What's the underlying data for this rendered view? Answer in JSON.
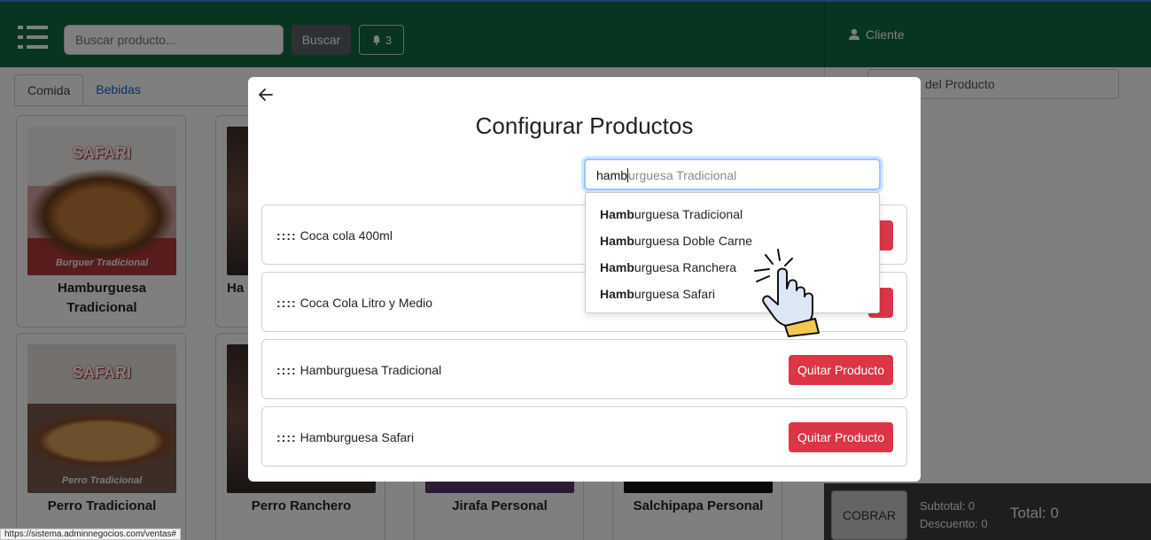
{
  "header": {
    "search_placeholder": "Buscar producto...",
    "search_button": "Buscar",
    "notifications_count": "3",
    "client_label": "Cliente"
  },
  "tabs": [
    {
      "label": "Comida"
    },
    {
      "label": "Bebidas"
    }
  ],
  "products": [
    {
      "name": "Hamburguesa Tradicional",
      "logo": "SAFARI",
      "caption": "Burguer Tradicional"
    },
    {
      "name": "Ha"
    },
    {
      "name": "Perro Tradicional",
      "logo": "SAFARI",
      "caption": "Perro Tradicional"
    },
    {
      "name": "Perro Ranchero"
    },
    {
      "name": "Jirafa Personal"
    },
    {
      "name": "Salchipapa Personal"
    }
  ],
  "right_panel": {
    "product_field_value": "del Producto"
  },
  "footer": {
    "cobrar_label": "COBRAR",
    "subtotal": "Subtotal: 0",
    "discount": "Descuento: 0",
    "total": "Total: 0"
  },
  "modal": {
    "title": "Configurar Productos",
    "input_typed": "hamb",
    "input_suggestion": "urguesa Tradicional",
    "rows": [
      {
        "label": "Coca cola 400ml",
        "button": ""
      },
      {
        "label": "Coca Cola Litro y Medio",
        "button": ""
      },
      {
        "label": "Hamburguesa Tradicional",
        "button": "Quitar Producto"
      },
      {
        "label": "Hamburguesa Safari",
        "button": "Quitar Producto"
      }
    ],
    "grip": "::::",
    "suggestions": [
      {
        "match": "Hamb",
        "rest": "urguesa Tradicional"
      },
      {
        "match": "Hamb",
        "rest": "urguesa Doble Carne"
      },
      {
        "match": "Hamb",
        "rest": "urguesa Ranchera"
      },
      {
        "match": "Hamb",
        "rest": "urguesa Safari"
      }
    ]
  },
  "status_url": "https://sistema.adminnegocios.com/ventas#",
  "colors": {
    "header_green": "#0e6b41",
    "danger_red": "#dc3545",
    "link_blue": "#1a5fd6"
  }
}
